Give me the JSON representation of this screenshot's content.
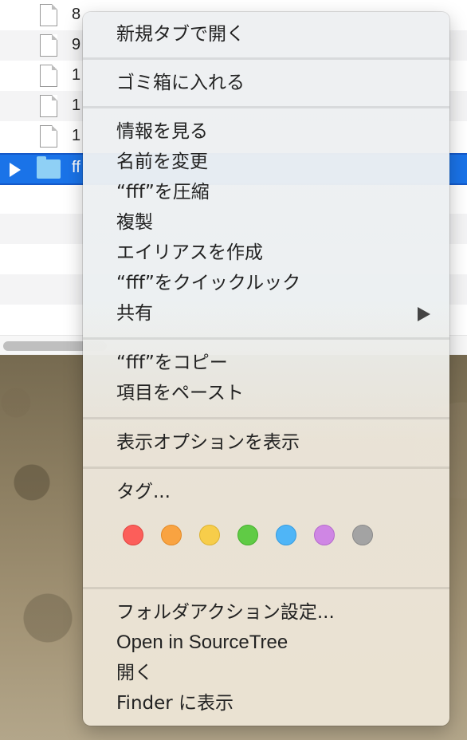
{
  "finder": {
    "rows": [
      {
        "name": "8"
      },
      {
        "name": "9"
      },
      {
        "name": "1"
      },
      {
        "name": "1"
      },
      {
        "name": "1"
      },
      {
        "name": "ff"
      }
    ]
  },
  "menu": {
    "items": {
      "open_new_tab": "新規タブで開く",
      "move_to_trash": "ゴミ箱に入れる",
      "get_info": "情報を見る",
      "rename": "名前を変更",
      "compress": "“fff”を圧縮",
      "duplicate": "複製",
      "make_alias": "エイリアスを作成",
      "quick_look": "“fff”をクイックルック",
      "share": "共有",
      "copy": "“fff”をコピー",
      "paste": "項目をペースト",
      "show_view_options": "表示オプションを表示",
      "tags": "タグ...",
      "folder_actions": "フォルダアクション設定...",
      "open_in_sourcetree": "Open in SourceTree",
      "open": "開く",
      "show_in_finder": "Finder に表示"
    },
    "tag_colors": [
      {
        "name": "red",
        "fill": "#fc5e5a",
        "border": "#e0443f"
      },
      {
        "name": "orange",
        "fill": "#f9a341",
        "border": "#e38a27"
      },
      {
        "name": "yellow",
        "fill": "#f7cd4a",
        "border": "#ddb332"
      },
      {
        "name": "green",
        "fill": "#60cb45",
        "border": "#45b02d"
      },
      {
        "name": "blue",
        "fill": "#4fb5f7",
        "border": "#349be0"
      },
      {
        "name": "purple",
        "fill": "#cf86e4",
        "border": "#b56ccc"
      },
      {
        "name": "gray",
        "fill": "#a3a3a3",
        "border": "#8a8a8a"
      }
    ]
  }
}
